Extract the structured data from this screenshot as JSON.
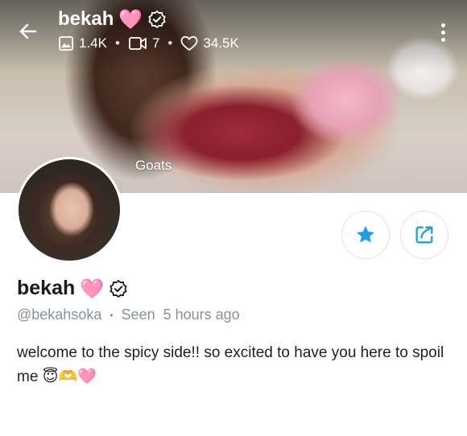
{
  "header": {
    "title": "bekah",
    "title_emoji": "🩷",
    "stats": [
      {
        "icon": "image-icon",
        "value": "1.4K"
      },
      {
        "icon": "video-icon",
        "value": "7"
      },
      {
        "icon": "heart-outline-icon",
        "value": "34.5K"
      }
    ],
    "separator": "•"
  },
  "cover": {
    "label": "Goats"
  },
  "profile": {
    "name": "bekah",
    "name_emoji": "🩷",
    "handle": "@bekahsoka",
    "separator": "•",
    "seen": "Seen  5 hours ago",
    "bio": "welcome to the spicy side!! so excited to have you here to spoil me 😇🫶🩷"
  },
  "colors": {
    "accent": "#1da1e6",
    "heart_pink": "#f8a6c9",
    "muted_text": "#8a9099"
  }
}
